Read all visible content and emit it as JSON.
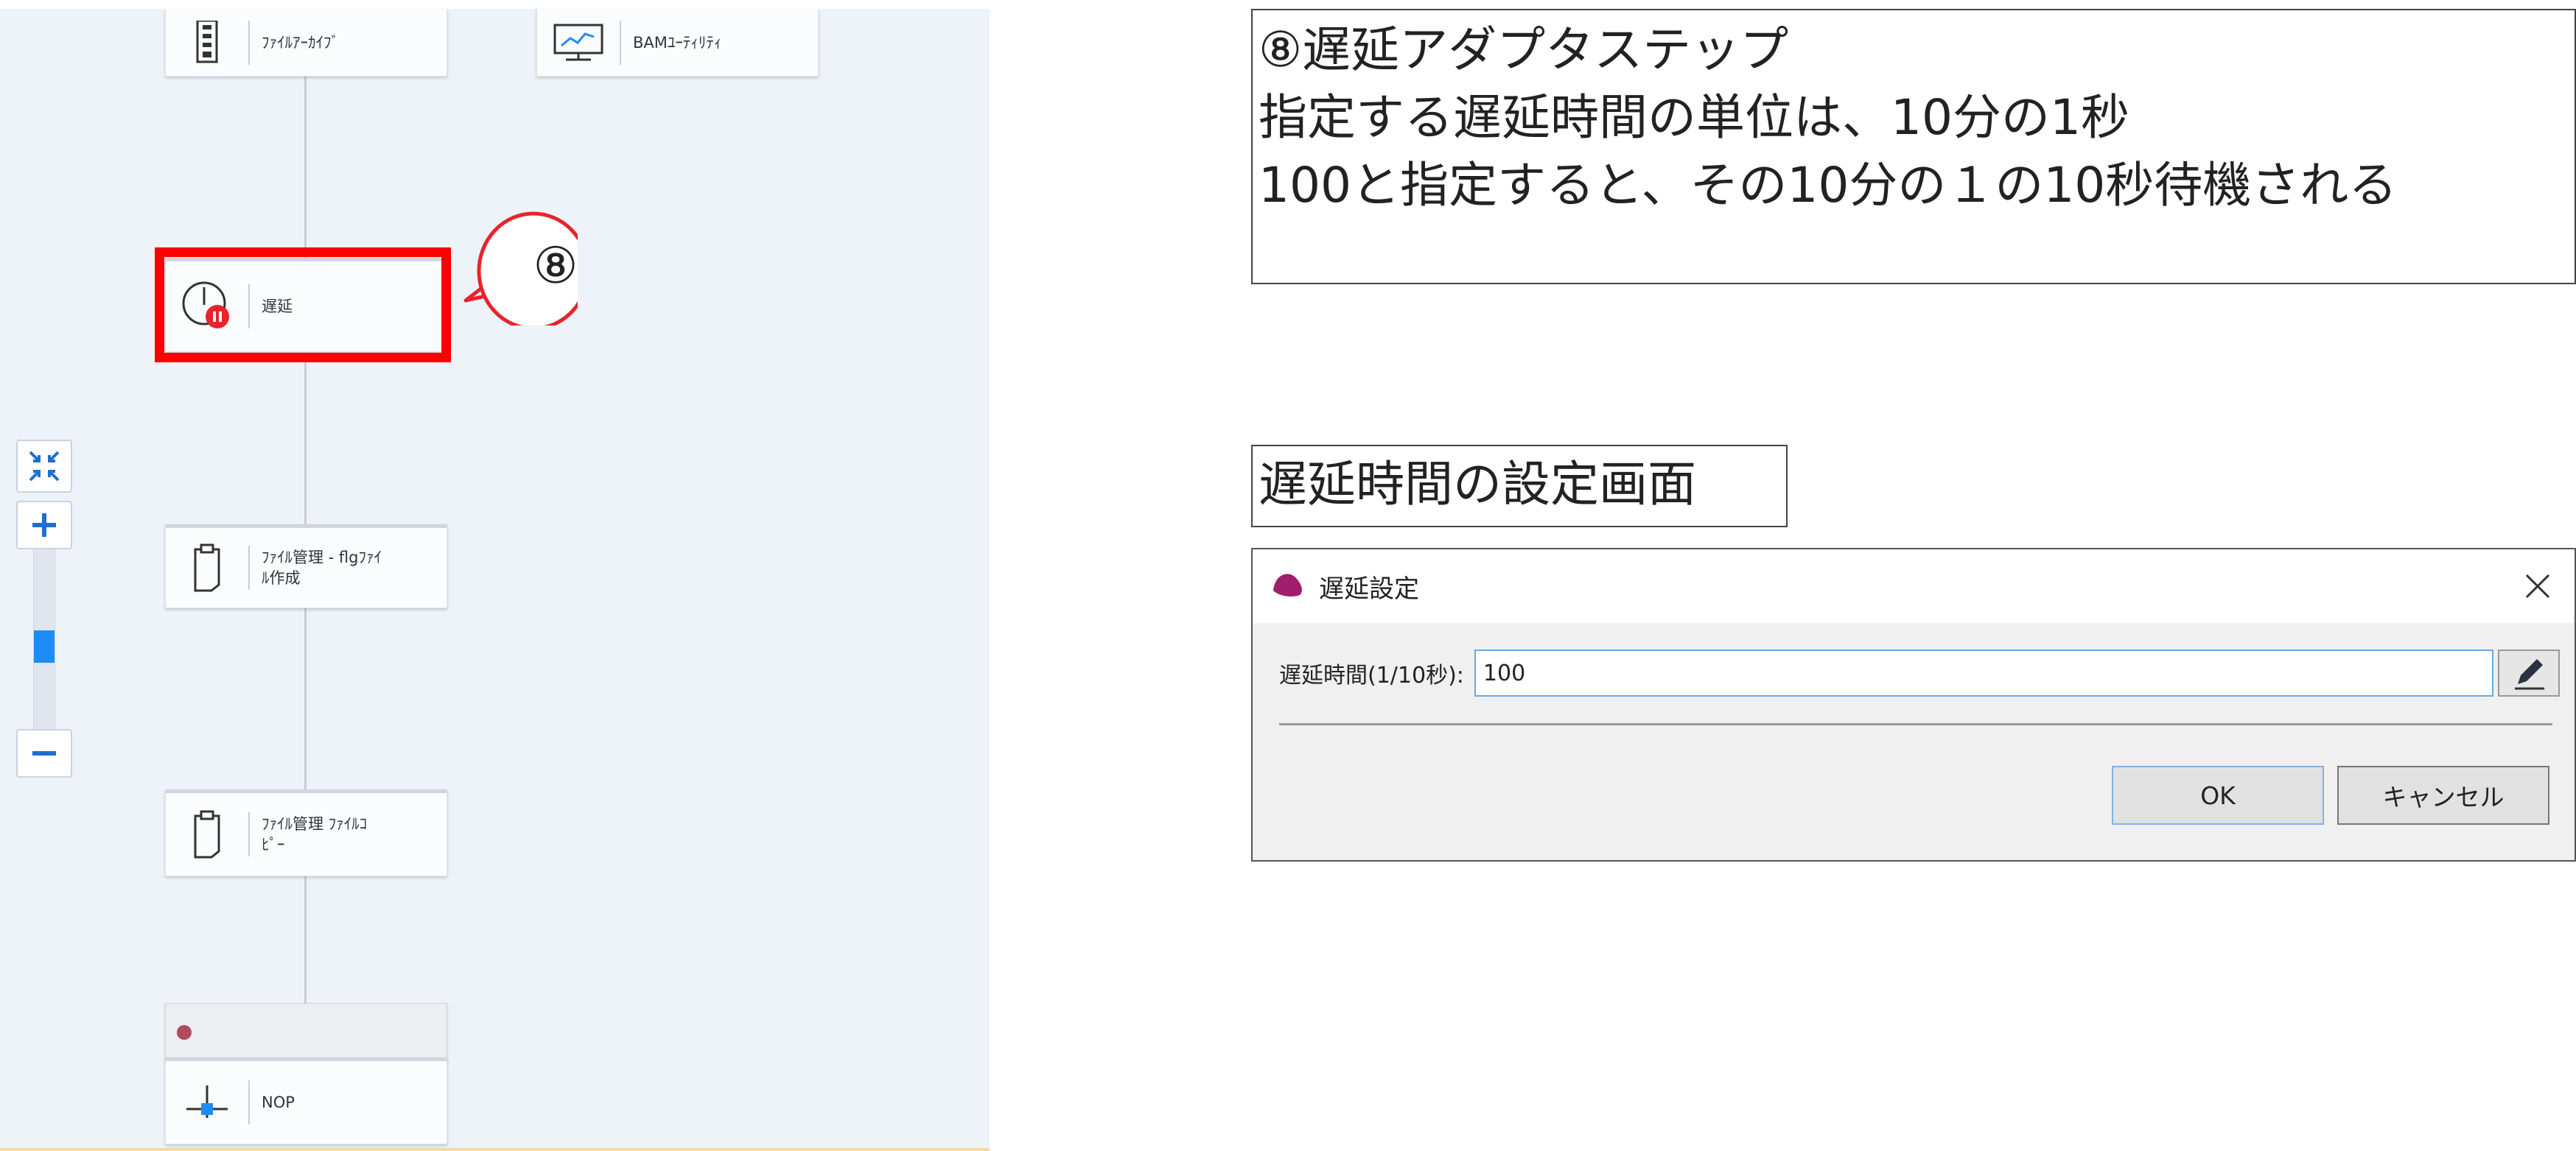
{
  "flow": {
    "nodes": [
      {
        "id": "archive",
        "label": "ﾌｧｲﾙｱｰｶｲﾌﾞ",
        "icon": "file-archive-icon"
      },
      {
        "id": "bam",
        "label": "BAMﾕｰﾃｨﾘﾃｨ",
        "icon": "monitor-chart-icon"
      },
      {
        "id": "delay",
        "label": "遅延",
        "icon": "clock-pause-icon"
      },
      {
        "id": "flg",
        "label": "ﾌｧｲﾙ管理 - flgﾌｧｲ\nﾙ作成",
        "icon": "clipboard-icon"
      },
      {
        "id": "copy",
        "label": "ﾌｧｲﾙ管理 ﾌｧｲﾙｺ\nﾋﾟｰ",
        "icon": "clipboard-icon"
      },
      {
        "id": "nop",
        "label": "NOP",
        "icon": "nop-connector-icon"
      }
    ],
    "callout_number": "⑧",
    "zoom": {
      "level": 0.45,
      "accent": "#1f8cf5"
    },
    "highlight_color": "#ff0000"
  },
  "notes": {
    "step_lines": [
      "⑧遅延アダプタステップ",
      "指定する遅延時間の単位は、10分の1秒",
      "100と指定すると、その10分の１の10秒待機される"
    ],
    "dialog_caption": "遅延時間の設定画面"
  },
  "dialog": {
    "title": "遅延設定",
    "field_label": "遅延時間(1/10秒):",
    "field_value": "100",
    "ok_label": "OK",
    "cancel_label": "キャンセル"
  }
}
